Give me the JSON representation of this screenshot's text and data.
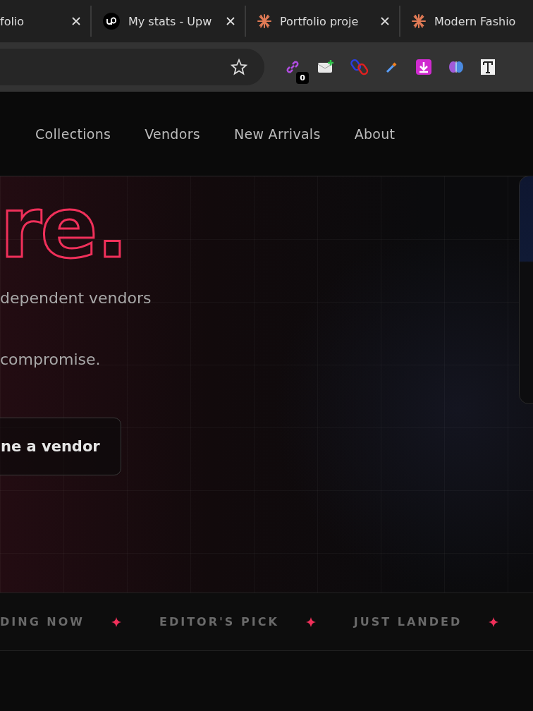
{
  "browser": {
    "tabs": [
      {
        "title": "folio",
        "kind": "plain",
        "selected": false
      },
      {
        "title": "My stats - Upw",
        "kind": "profile",
        "selected": false
      },
      {
        "title": "Portfolio proje",
        "kind": "project",
        "selected": false
      },
      {
        "title": "Modern Fashio",
        "kind": "project",
        "selected": false
      }
    ],
    "extensions": [
      {
        "kind": "link",
        "badge": "0"
      },
      {
        "kind": "mail"
      },
      {
        "kind": "chain"
      },
      {
        "kind": "dropper"
      },
      {
        "kind": "download"
      },
      {
        "kind": "brain"
      },
      {
        "kind": "text"
      }
    ]
  },
  "nav": {
    "links": [
      "Collections",
      "Vendors",
      "New Arrivals",
      "About"
    ]
  },
  "hero": {
    "heading": "re.",
    "lines": [
      "dependent vendors",
      "compromise."
    ],
    "button": "ne a vendor"
  },
  "marquee": [
    "DING NOW",
    "EDITOR'S PICK",
    "JUST LANDED"
  ]
}
